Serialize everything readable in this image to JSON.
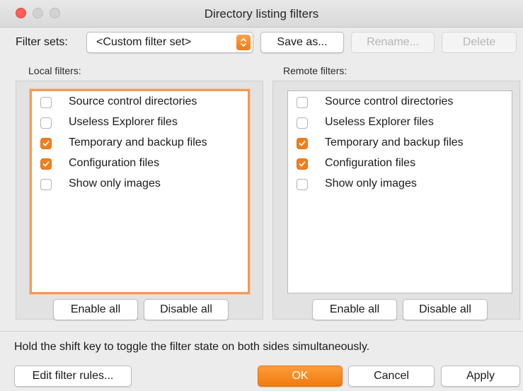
{
  "window": {
    "title": "Directory listing filters"
  },
  "filter_sets": {
    "label": "Filter sets:",
    "selected": "<Custom filter set>",
    "save_as": "Save as...",
    "rename": "Rename...",
    "delete": "Delete"
  },
  "local": {
    "label": "Local filters:",
    "items": [
      {
        "label": "Source control directories",
        "checked": false
      },
      {
        "label": "Useless Explorer files",
        "checked": false
      },
      {
        "label": "Temporary and backup files",
        "checked": true
      },
      {
        "label": "Configuration files",
        "checked": true
      },
      {
        "label": "Show only images",
        "checked": false
      }
    ],
    "enable_all": "Enable all",
    "disable_all": "Disable all"
  },
  "remote": {
    "label": "Remote filters:",
    "items": [
      {
        "label": "Source control directories",
        "checked": false
      },
      {
        "label": "Useless Explorer files",
        "checked": false
      },
      {
        "label": "Temporary and backup files",
        "checked": true
      },
      {
        "label": "Configuration files",
        "checked": true
      },
      {
        "label": "Show only images",
        "checked": false
      }
    ],
    "enable_all": "Enable all",
    "disable_all": "Disable all"
  },
  "hint": "Hold the shift key to toggle the filter state on both sides simultaneously.",
  "footer": {
    "edit_rules": "Edit filter rules...",
    "ok": "OK",
    "cancel": "Cancel",
    "apply": "Apply"
  },
  "colors": {
    "accent": "#f07f1c",
    "close": "#ff5f57"
  }
}
